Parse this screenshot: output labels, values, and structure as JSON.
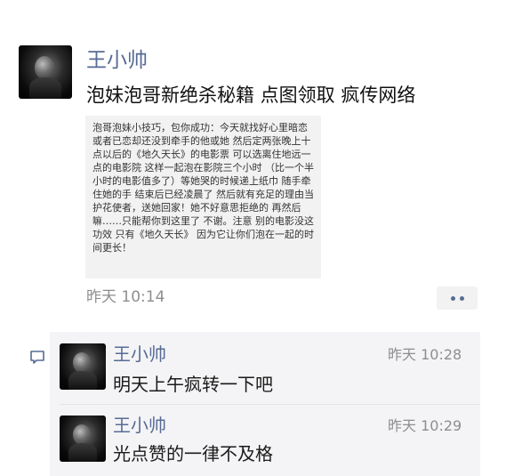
{
  "post": {
    "author": "王小帅",
    "text": "泡妹泡哥新绝杀秘籍 点图领取 疯传网络",
    "shared_text": "泡哥泡妹小技巧，包你成功：今天就找好心里暗恋 或者已恋却还没到牵手的他或她 然后定两张晚上十点以后的《地久天长》的电影票 可以选离住地远一点的电影院 这样一起泡在影院三个小时 （比一个半小时的电影值多了）等她哭的时候递上纸巾 随手牵住她的手 结束后已经凌晨了 然后就有充足的理由当护花使者，送她回家！她不好意思拒绝的 再然后嘛……只能帮你到这里了 不谢。注意 别的电影没这功效 只有《地久天长》 因为它让你们泡在一起的时间更长！",
    "time": "昨天 10:14"
  },
  "icons": {
    "more": "more-dots-icon",
    "comment": "comment-bubble-icon",
    "avatar": "user-avatar"
  },
  "comments": [
    {
      "name": "王小帅",
      "time": "昨天 10:28",
      "text": "明天上午疯转一下吧"
    },
    {
      "name": "王小帅",
      "time": "昨天 10:29",
      "text": "光点赞的一律不及格"
    }
  ],
  "colors": {
    "name_link": "#576b95",
    "comments_bg": "#f4f4f6",
    "card_bg": "#f3f2f2",
    "time_gray": "#8e8e8e"
  }
}
